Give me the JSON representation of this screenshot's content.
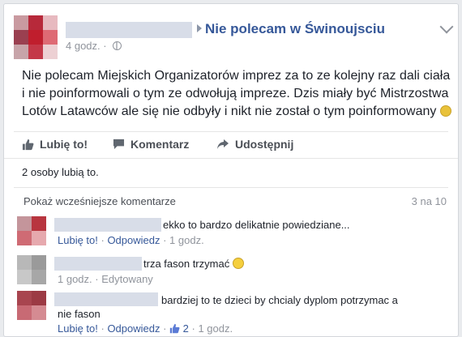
{
  "post": {
    "page_name": "Nie polecam w Świnoujsciu",
    "time": "4 godz. ·",
    "text": "Nie polecam Miejskich Organizatorów imprez za to ze kolejny raz dali ciała i nie poinformowali o tym ze odwołują impreze. Dzis miały być Mistrzostwa Lotów Latawców ale się nie odbyły i nikt nie został o tym poinformowany"
  },
  "actions": {
    "like": "Lubię to!",
    "comment": "Komentarz",
    "share": "Udostępnij"
  },
  "likes_summary": "2 osoby lubią to.",
  "comments_header": {
    "more": "Pokaż wcześniejsze komentarze",
    "count": "3 na 10"
  },
  "comments": [
    {
      "text": "ekko to bardzo delikatnie powiedziane...",
      "like": "Lubię to!",
      "reply": "Odpowiedz",
      "time": "1 godz."
    },
    {
      "text": "trza fason trzymać",
      "time": "1 godz.",
      "edited": "Edytowany"
    },
    {
      "text": "bardziej to te dzieci by chcialy dyplom potrzymac a nie fason",
      "like": "Lubię to!",
      "reply": "Odpowiedz",
      "likes": "2",
      "time": "1 godz."
    }
  ],
  "colors": {
    "link": "#365899",
    "muted": "#90949c",
    "text": "#1d2129",
    "blur": "#d8dde8"
  }
}
